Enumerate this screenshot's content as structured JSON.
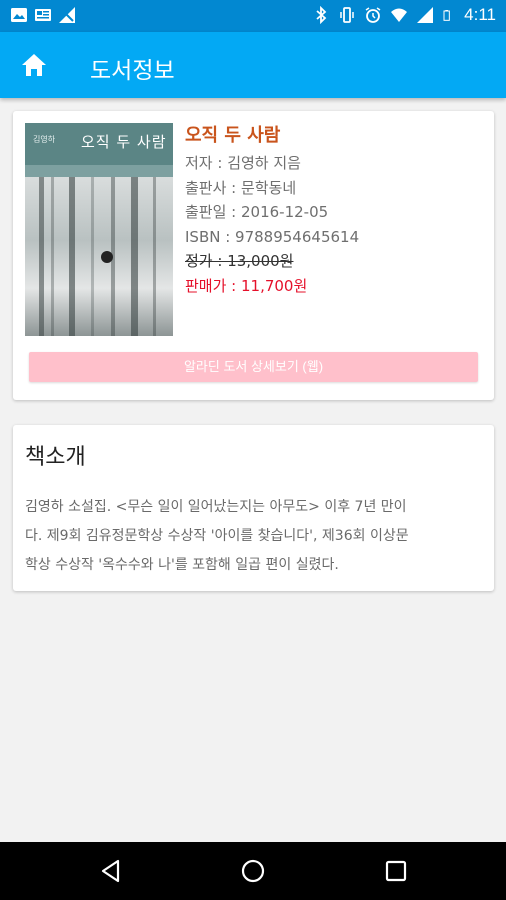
{
  "status_bar": {
    "time": "4:11",
    "left_icons": [
      "image-icon",
      "news-icon",
      "signal-off-icon"
    ],
    "right_icons": [
      "bluetooth-icon",
      "vibrate-icon",
      "alarm-icon",
      "wifi-icon",
      "signal-icon",
      "battery-icon"
    ],
    "color": "#0288d1"
  },
  "app_bar": {
    "title": "도서정보",
    "icon": "home-icon",
    "color": "#03a9f4"
  },
  "book": {
    "cover": {
      "author": "김영하",
      "title": "오직 두 사람"
    },
    "title": "오직 두 사람",
    "author_line": "저자 : 김영하 지음",
    "publisher_line": "출판사 : 문학동네",
    "date_line": "출판일 : 2016-12-05",
    "isbn_line": "ISBN : 9788954645614",
    "list_price_line": "정가 : 13,000원",
    "sale_price_line": "판매가 : 11,700원",
    "detail_button": "알라딘 도서 상세보기 (웹)",
    "title_color": "#c9541c",
    "sale_color": "#e5102a",
    "button_color": "#ffc0cb"
  },
  "intro": {
    "heading": "책소개",
    "lines": [
      "김영하 소설집. <무슨 일이 일어났는지는 아무도> 이후 7년 만이",
      "다. 제9회 김유정문학상 수상작 '아이를 찾습니다', 제36회 이상문",
      "학상 수상작 '옥수수와 나'를 포함해 일곱 편이 실렸다."
    ]
  },
  "nav_bar": {
    "buttons": [
      "back-icon",
      "home-circle-icon",
      "recents-icon"
    ]
  }
}
